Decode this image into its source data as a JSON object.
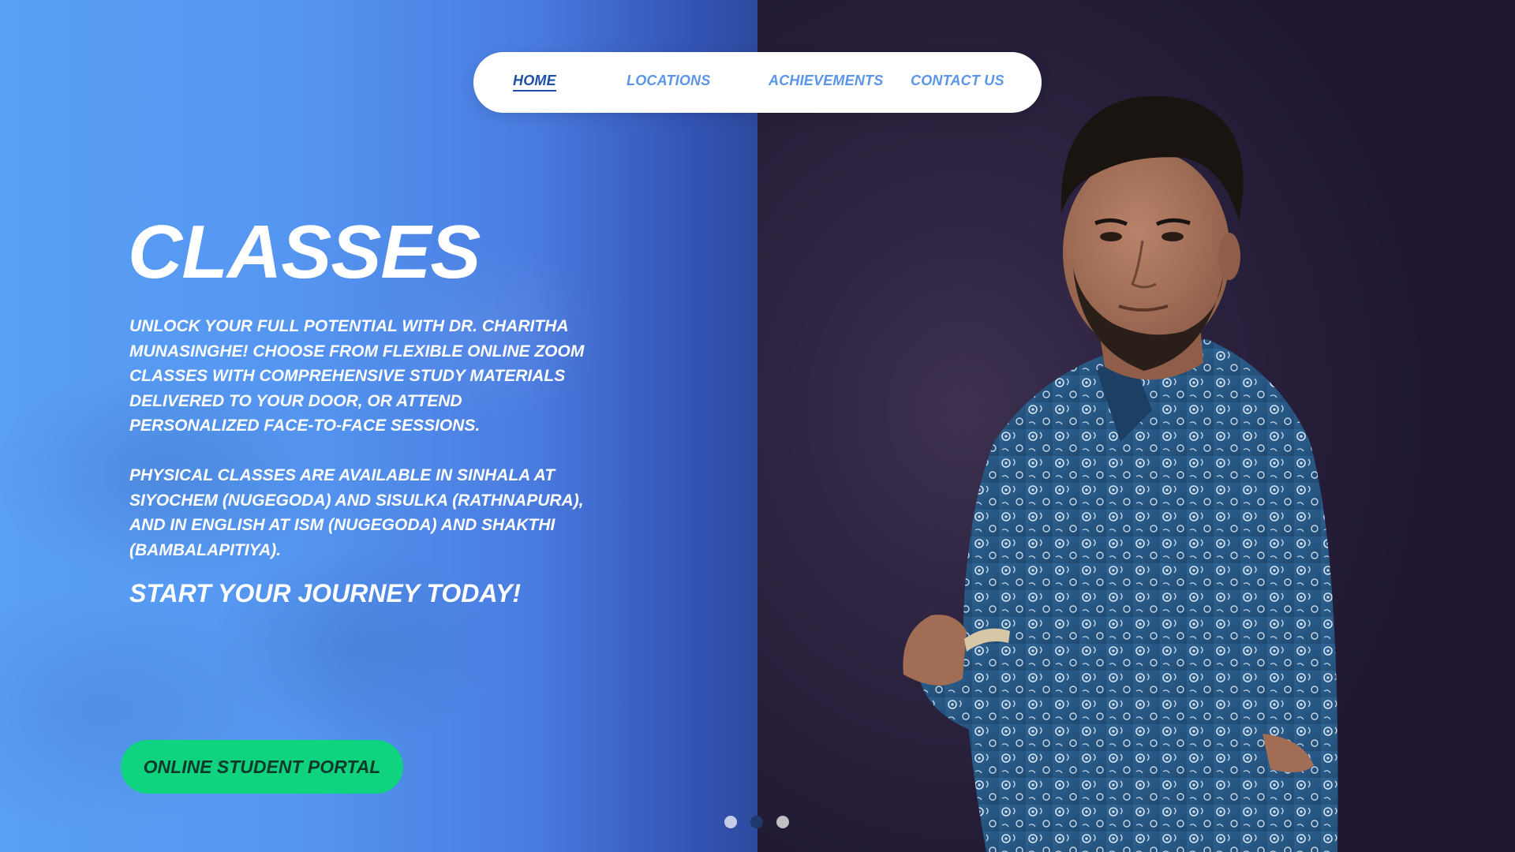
{
  "nav": {
    "items": [
      {
        "label": "HOME",
        "active": true
      },
      {
        "label": "LOCATIONS",
        "active": false
      },
      {
        "label": "ACHIEVEMENTS",
        "active": false
      },
      {
        "label": "CONTACT US",
        "active": false
      }
    ]
  },
  "hero": {
    "title": "CLASSES",
    "paragraph_1": "UNLOCK YOUR FULL POTENTIAL WITH DR. CHARITHA MUNASINGHE! CHOOSE FROM FLEXIBLE ONLINE ZOOM CLASSES WITH COMPREHENSIVE STUDY MATERIALS DELIVERED TO YOUR DOOR, OR ATTEND PERSONALIZED FACE-TO-FACE SESSIONS.",
    "paragraph_2": "PHYSICAL CLASSES ARE AVAILABLE IN SINHALA AT SIYOCHEM (NUGEGODA) AND SISULKA (RATHNAPURA), AND IN ENGLISH AT ISM (NUGEGODA) AND SHAKTHI (BAMBALAPITIYA).",
    "tagline": "START YOUR JOURNEY TODAY!",
    "button_label": "ONLINE STUDENT PORTAL"
  },
  "carousel": {
    "slide_count": 3,
    "active_slide": 2
  },
  "colors": {
    "accent_green": "#10d37f",
    "nav_active": "#1d4fa8",
    "nav_link": "#5a95e8",
    "hero_blue": "#5495f0",
    "photo_bg": "#2c2340"
  }
}
